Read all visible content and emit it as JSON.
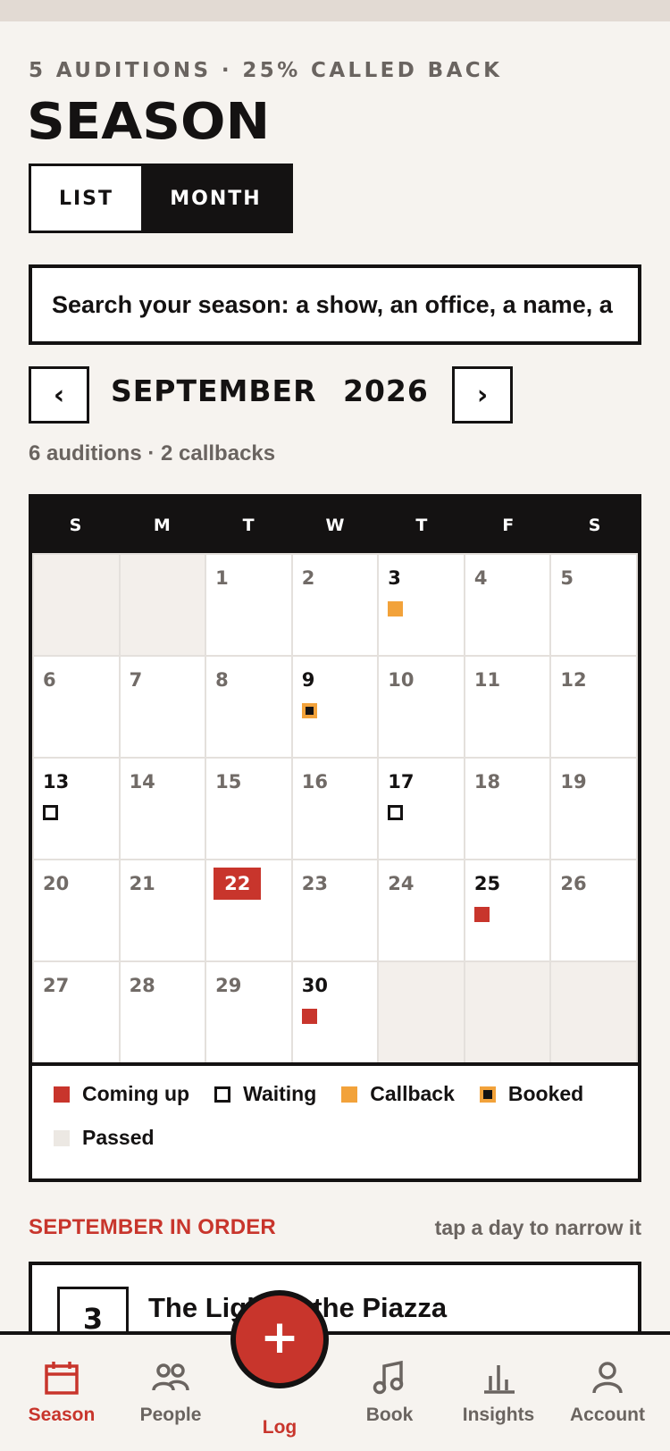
{
  "header": {
    "eyebrow": "5 AUDITIONS · 25% CALLED BACK",
    "title": "SEASON"
  },
  "view_toggle": {
    "options": [
      "LIST",
      "MONTH"
    ],
    "selected": "MONTH"
  },
  "search": {
    "placeholder": "Search your season: a show, an office, a name, a note",
    "value": ""
  },
  "month_nav": {
    "prev_icon": "chevron-left-icon",
    "prev_glyph": "‹",
    "next_icon": "chevron-right-icon",
    "next_glyph": "›",
    "month": "SEPTEMBER",
    "year": "2026",
    "summary": "6 auditions · 2 callbacks"
  },
  "calendar": {
    "weekdays": [
      "S",
      "M",
      "T",
      "W",
      "T",
      "F",
      "S"
    ],
    "leading_blanks": 2,
    "trailing_blanks": 3,
    "days": [
      {
        "day": "1",
        "status": ""
      },
      {
        "day": "2",
        "status": ""
      },
      {
        "day": "3",
        "status": "callback"
      },
      {
        "day": "4",
        "status": ""
      },
      {
        "day": "5",
        "status": ""
      },
      {
        "day": "6",
        "status": ""
      },
      {
        "day": "7",
        "status": ""
      },
      {
        "day": "8",
        "status": ""
      },
      {
        "day": "9",
        "status": "booked"
      },
      {
        "day": "10",
        "status": ""
      },
      {
        "day": "11",
        "status": ""
      },
      {
        "day": "12",
        "status": ""
      },
      {
        "day": "13",
        "status": "waiting"
      },
      {
        "day": "14",
        "status": ""
      },
      {
        "day": "15",
        "status": ""
      },
      {
        "day": "16",
        "status": ""
      },
      {
        "day": "17",
        "status": "waiting"
      },
      {
        "day": "18",
        "status": ""
      },
      {
        "day": "19",
        "status": ""
      },
      {
        "day": "20",
        "status": ""
      },
      {
        "day": "21",
        "status": ""
      },
      {
        "day": "22",
        "status": "",
        "today": true
      },
      {
        "day": "23",
        "status": ""
      },
      {
        "day": "24",
        "status": ""
      },
      {
        "day": "25",
        "status": "coming"
      },
      {
        "day": "26",
        "status": ""
      },
      {
        "day": "27",
        "status": ""
      },
      {
        "day": "28",
        "status": ""
      },
      {
        "day": "29",
        "status": ""
      },
      {
        "day": "30",
        "status": "coming"
      }
    ]
  },
  "legend": [
    {
      "key": "coming",
      "label": "Coming up"
    },
    {
      "key": "waiting",
      "label": "Waiting"
    },
    {
      "key": "callback",
      "label": "Callback"
    },
    {
      "key": "booked",
      "label": "Booked"
    },
    {
      "key": "passed",
      "label": "Passed"
    }
  ],
  "colors": {
    "accent": "#c8352c",
    "callback": "#f2a23a",
    "ink": "#141212",
    "paper": "#f6f3ef",
    "muted": "#6a6460"
  },
  "list_section": {
    "heading": "SEPTEMBER IN ORDER",
    "hint": "tap a day to narrow it",
    "first_entry": {
      "day": "3",
      "title": "The Light in the Piazza"
    }
  },
  "tabbar": {
    "tabs": [
      {
        "label": "Season",
        "icon": "calendar-icon",
        "active": true
      },
      {
        "label": "People",
        "icon": "people-icon",
        "active": false
      },
      {
        "label": "Book",
        "icon": "music-note-icon",
        "active": false
      },
      {
        "label": "Insights",
        "icon": "bar-chart-icon",
        "active": false
      },
      {
        "label": "Account",
        "icon": "user-icon",
        "active": false
      }
    ],
    "fab": {
      "glyph": "+",
      "label": "Log",
      "icon": "plus-icon"
    }
  }
}
